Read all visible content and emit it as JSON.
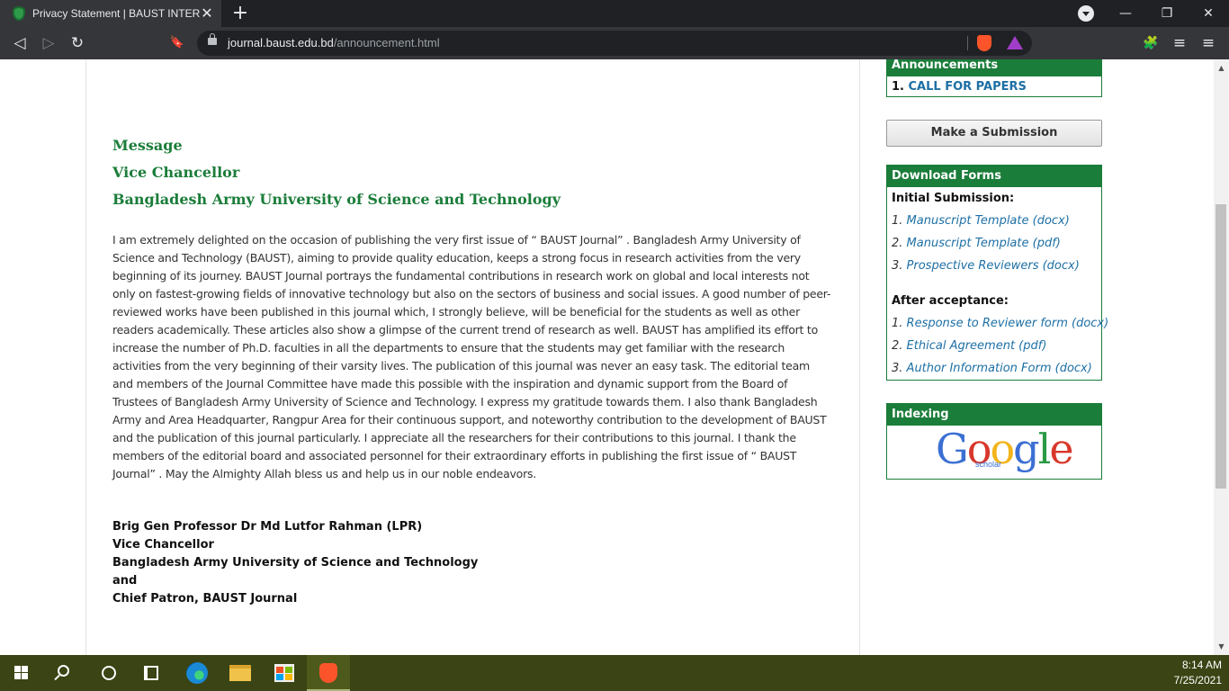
{
  "browser": {
    "tab_title": "Privacy Statement | BAUST INTERNATIONAL",
    "tab_close": "✕",
    "new_tab": "+",
    "url_host": "journal.baust.edu.bd",
    "url_path": "/announcement.html",
    "back": "◁",
    "forward": "▷",
    "reload": "↻",
    "bookmark": "🔖",
    "minimize": "—",
    "restore": "❐",
    "close": "✕",
    "extensions": "🧩",
    "playlist": "≡",
    "menu": "≡"
  },
  "message": {
    "heading1": "Message",
    "heading2": "Vice Chancellor",
    "heading3": "Bangladesh Army University of Science and Technology",
    "body": "I am extremely delighted on the occasion of publishing the very first issue of “ BAUST Journal” . Bangladesh Army University of Science and Technology (BAUST), aiming to provide quality education, keeps a strong focus in research activities from the very beginning of its journey. BAUST Journal portrays the fundamental contributions in research work on global and local interests not only on fastest-growing fields of innovative technology but also on the sectors of business and social issues. A good number of peer-reviewed works have been published in this journal which, I strongly believe, will be beneficial for the students as well as other readers academically. These articles also show a glimpse of the current trend of research as well. BAUST has amplified its effort to increase the number of Ph.D. faculties in all the departments to ensure that the students may get familiar with the research activities from the very beginning of their varsity lives. The publication of this journal was never an easy task. The editorial team and members of the Journal Committee have made this possible with the inspiration and dynamic support from the Board of Trustees of Bangladesh Army University of Science and Technology. I express my gratitude towards them. I also thank Bangladesh Army and Area Headquarter, Rangpur Area for their continuous support, and noteworthy contribution to the development of BAUST and the publication of this journal particularly. I appreciate all the researchers for their contributions to this journal. I thank the members of the editorial board and associated personnel for their extraordinary efforts in publishing the first issue of “ BAUST Journal” . May the Almighty Allah bless us and help us in our noble endeavors."
  },
  "signature": {
    "line1": "Brig Gen Professor Dr Md Lutfor Rahman (LPR)",
    "line2": "Vice Chancellor",
    "line3": "Bangladesh Army University of Science and Technology",
    "line4": "and",
    "line5": "Chief Patron, BAUST Journal"
  },
  "sidebar": {
    "announcements_title": "Announcements",
    "announcement_num": "1.",
    "announcement_item": "CALL FOR PAPERS",
    "submit_button": "Make a Submission",
    "download_title": "Download Forms",
    "initial_label": "Initial Submission:",
    "initial_items": [
      {
        "num": "1.",
        "label": "Manuscript Template (docx)"
      },
      {
        "num": "2.",
        "label": "Manuscript Template (pdf)"
      },
      {
        "num": "3.",
        "label": "Prospective Reviewers (docx)"
      }
    ],
    "after_label": "After acceptance:",
    "after_items": [
      {
        "num": "1.",
        "label": "Response to Reviewer form (docx)"
      },
      {
        "num": "2.",
        "label": "Ethical Agreement (pdf)"
      },
      {
        "num": "3.",
        "label": "Author Information Form (docx)"
      }
    ],
    "indexing_title": "Indexing",
    "google_letters": [
      "G",
      "o",
      "o",
      "g",
      "l",
      "e"
    ],
    "google_colors": [
      "#3b6fd3",
      "#d8372b",
      "#f2b41a",
      "#3b6fd3",
      "#2a9a44",
      "#d8372b"
    ],
    "scholar_text": "scholar"
  },
  "taskbar": {
    "time": "8:14 AM",
    "date": "7/25/2021"
  }
}
